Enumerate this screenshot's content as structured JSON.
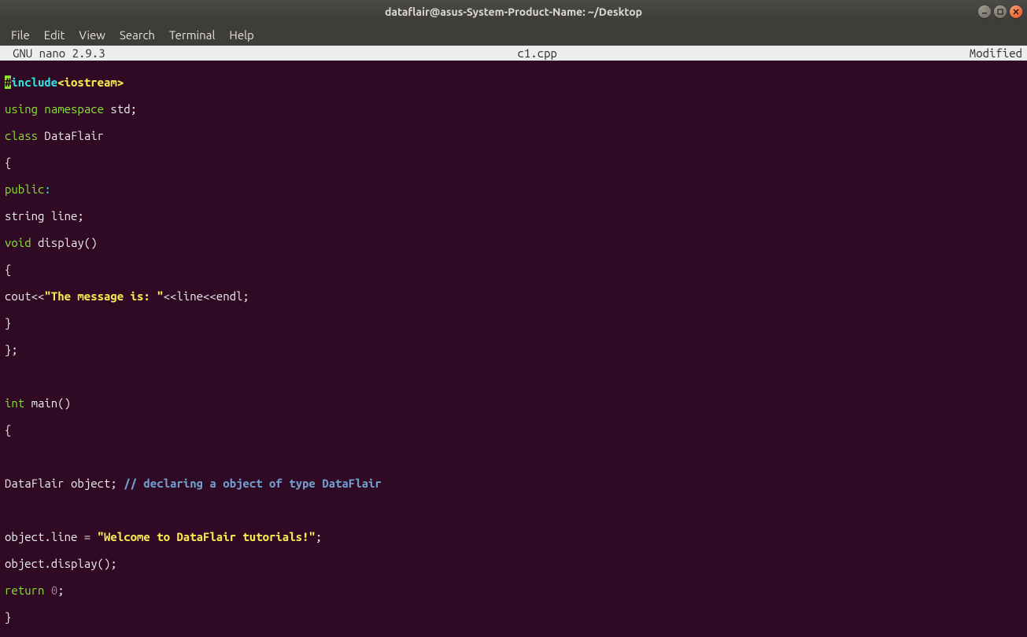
{
  "titlebar": {
    "title": "dataflair@asus-System-Product-Name: ~/Desktop"
  },
  "menubar": {
    "items": [
      "File",
      "Edit",
      "View",
      "Search",
      "Terminal",
      "Help"
    ]
  },
  "nano_status": {
    "left": "GNU nano 2.9.3",
    "center": "c1.cpp",
    "right": "Modified"
  },
  "code": {
    "l1": {
      "hash": "#",
      "kw": "include",
      "hdr": "<iostream>"
    },
    "l2": {
      "a": "using",
      "b": "namespace",
      "c": " std;"
    },
    "l3": {
      "a": "class",
      "b": " DataFlair"
    },
    "l4": "{",
    "l5": {
      "a": "public",
      "b": ":"
    },
    "l6": "string line;",
    "l7": {
      "a": "void",
      "b": " display()"
    },
    "l8": "{",
    "l9": {
      "a": "cout<<",
      "b": "\"The message is: \"",
      "c": "<<line<<endl;"
    },
    "l10": "}",
    "l11": "};",
    "l12": "",
    "l13": {
      "a": "int",
      "b": " main()"
    },
    "l14": "{",
    "l15": "",
    "l16": {
      "a": "DataFlair object; ",
      "b": "// declaring a object of type DataFlair"
    },
    "l17": "",
    "l18": {
      "a": "object.line = ",
      "b": "\"Welcome to DataFlair tutorials!\"",
      "c": ";"
    },
    "l19": "object.display();",
    "l20": {
      "a": "return",
      "b": " ",
      "c": "0",
      "d": ";"
    },
    "l21": "}"
  }
}
